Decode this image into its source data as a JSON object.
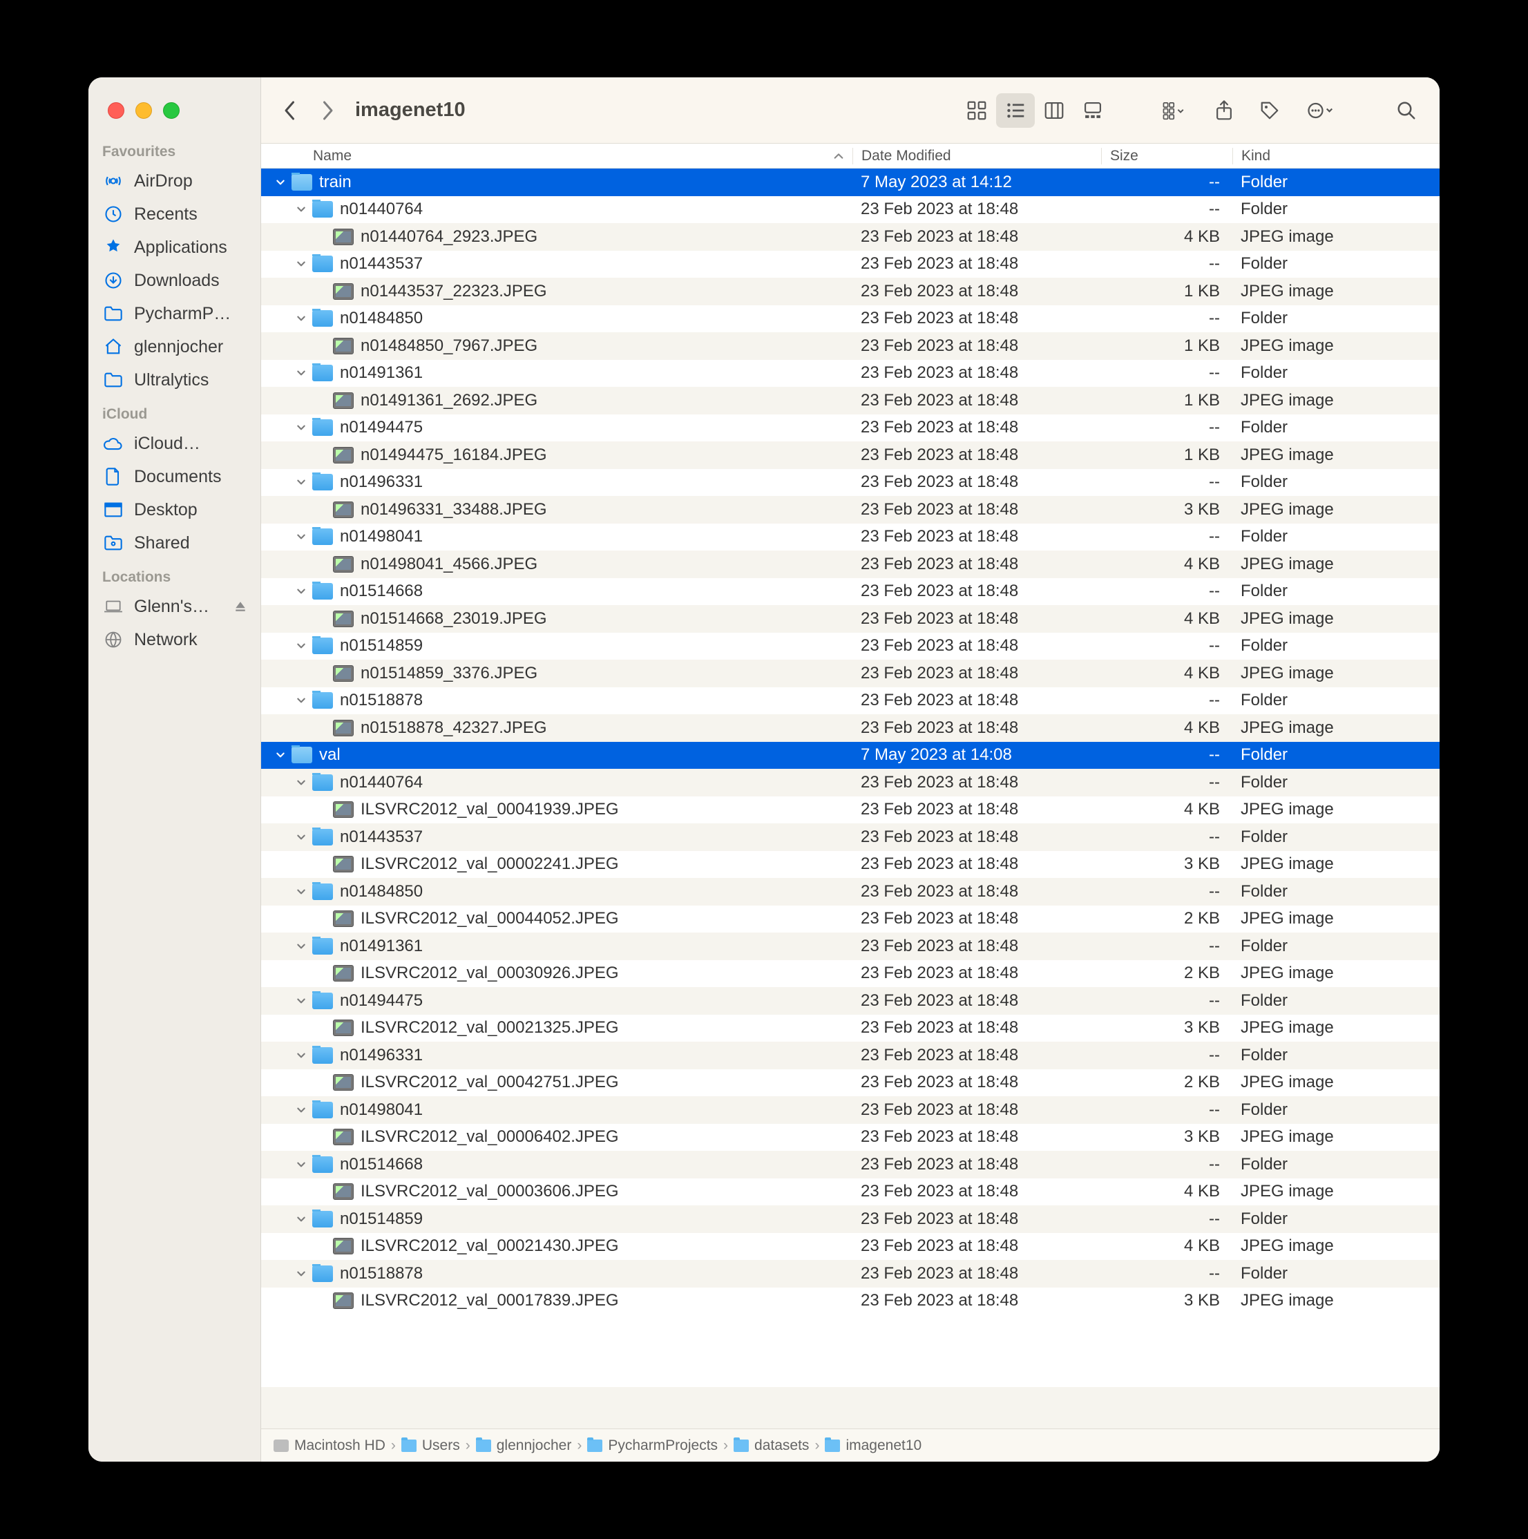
{
  "window": {
    "title": "imagenet10"
  },
  "sidebar": {
    "sections": [
      {
        "title": "Favourites",
        "items": [
          {
            "icon": "airdrop",
            "label": "AirDrop"
          },
          {
            "icon": "clock",
            "label": "Recents"
          },
          {
            "icon": "apps",
            "label": "Applications"
          },
          {
            "icon": "download",
            "label": "Downloads"
          },
          {
            "icon": "folder",
            "label": "PycharmP…"
          },
          {
            "icon": "home",
            "label": "glennjocher"
          },
          {
            "icon": "folder",
            "label": "Ultralytics"
          }
        ]
      },
      {
        "title": "iCloud",
        "items": [
          {
            "icon": "cloud",
            "label": "iCloud…"
          },
          {
            "icon": "doc",
            "label": "Documents"
          },
          {
            "icon": "desktop",
            "label": "Desktop"
          },
          {
            "icon": "shared",
            "label": "Shared"
          }
        ]
      },
      {
        "title": "Locations",
        "items": [
          {
            "icon": "laptop",
            "label": "Glenn's…",
            "eject": true
          },
          {
            "icon": "network",
            "label": "Network"
          }
        ]
      }
    ]
  },
  "columns": {
    "name": "Name",
    "date": "Date Modified",
    "size": "Size",
    "kind": "Kind"
  },
  "rows": [
    {
      "depth": 0,
      "type": "folder",
      "name": "train",
      "date": "7 May 2023 at 14:12",
      "size": "--",
      "kind": "Folder",
      "selected": true,
      "disclosed": true
    },
    {
      "depth": 1,
      "type": "folder",
      "name": "n01440764",
      "date": "23 Feb 2023 at 18:48",
      "size": "--",
      "kind": "Folder",
      "disclosed": true
    },
    {
      "depth": 2,
      "type": "img",
      "name": "n01440764_2923.JPEG",
      "date": "23 Feb 2023 at 18:48",
      "size": "4 KB",
      "kind": "JPEG image"
    },
    {
      "depth": 1,
      "type": "folder",
      "name": "n01443537",
      "date": "23 Feb 2023 at 18:48",
      "size": "--",
      "kind": "Folder",
      "disclosed": true
    },
    {
      "depth": 2,
      "type": "img",
      "name": "n01443537_22323.JPEG",
      "date": "23 Feb 2023 at 18:48",
      "size": "1 KB",
      "kind": "JPEG image"
    },
    {
      "depth": 1,
      "type": "folder",
      "name": "n01484850",
      "date": "23 Feb 2023 at 18:48",
      "size": "--",
      "kind": "Folder",
      "disclosed": true
    },
    {
      "depth": 2,
      "type": "img",
      "name": "n01484850_7967.JPEG",
      "date": "23 Feb 2023 at 18:48",
      "size": "1 KB",
      "kind": "JPEG image"
    },
    {
      "depth": 1,
      "type": "folder",
      "name": "n01491361",
      "date": "23 Feb 2023 at 18:48",
      "size": "--",
      "kind": "Folder",
      "disclosed": true
    },
    {
      "depth": 2,
      "type": "img",
      "name": "n01491361_2692.JPEG",
      "date": "23 Feb 2023 at 18:48",
      "size": "1 KB",
      "kind": "JPEG image"
    },
    {
      "depth": 1,
      "type": "folder",
      "name": "n01494475",
      "date": "23 Feb 2023 at 18:48",
      "size": "--",
      "kind": "Folder",
      "disclosed": true
    },
    {
      "depth": 2,
      "type": "img",
      "name": "n01494475_16184.JPEG",
      "date": "23 Feb 2023 at 18:48",
      "size": "1 KB",
      "kind": "JPEG image"
    },
    {
      "depth": 1,
      "type": "folder",
      "name": "n01496331",
      "date": "23 Feb 2023 at 18:48",
      "size": "--",
      "kind": "Folder",
      "disclosed": true
    },
    {
      "depth": 2,
      "type": "img",
      "name": "n01496331_33488.JPEG",
      "date": "23 Feb 2023 at 18:48",
      "size": "3 KB",
      "kind": "JPEG image"
    },
    {
      "depth": 1,
      "type": "folder",
      "name": "n01498041",
      "date": "23 Feb 2023 at 18:48",
      "size": "--",
      "kind": "Folder",
      "disclosed": true
    },
    {
      "depth": 2,
      "type": "img",
      "name": "n01498041_4566.JPEG",
      "date": "23 Feb 2023 at 18:48",
      "size": "4 KB",
      "kind": "JPEG image"
    },
    {
      "depth": 1,
      "type": "folder",
      "name": "n01514668",
      "date": "23 Feb 2023 at 18:48",
      "size": "--",
      "kind": "Folder",
      "disclosed": true
    },
    {
      "depth": 2,
      "type": "img",
      "name": "n01514668_23019.JPEG",
      "date": "23 Feb 2023 at 18:48",
      "size": "4 KB",
      "kind": "JPEG image"
    },
    {
      "depth": 1,
      "type": "folder",
      "name": "n01514859",
      "date": "23 Feb 2023 at 18:48",
      "size": "--",
      "kind": "Folder",
      "disclosed": true
    },
    {
      "depth": 2,
      "type": "img",
      "name": "n01514859_3376.JPEG",
      "date": "23 Feb 2023 at 18:48",
      "size": "4 KB",
      "kind": "JPEG image"
    },
    {
      "depth": 1,
      "type": "folder",
      "name": "n01518878",
      "date": "23 Feb 2023 at 18:48",
      "size": "--",
      "kind": "Folder",
      "disclosed": true
    },
    {
      "depth": 2,
      "type": "img",
      "name": "n01518878_42327.JPEG",
      "date": "23 Feb 2023 at 18:48",
      "size": "4 KB",
      "kind": "JPEG image"
    },
    {
      "depth": 0,
      "type": "folder",
      "name": "val",
      "date": "7 May 2023 at 14:08",
      "size": "--",
      "kind": "Folder",
      "selected": true,
      "disclosed": true
    },
    {
      "depth": 1,
      "type": "folder",
      "name": "n01440764",
      "date": "23 Feb 2023 at 18:48",
      "size": "--",
      "kind": "Folder",
      "disclosed": true
    },
    {
      "depth": 2,
      "type": "img",
      "name": "ILSVRC2012_val_00041939.JPEG",
      "date": "23 Feb 2023 at 18:48",
      "size": "4 KB",
      "kind": "JPEG image"
    },
    {
      "depth": 1,
      "type": "folder",
      "name": "n01443537",
      "date": "23 Feb 2023 at 18:48",
      "size": "--",
      "kind": "Folder",
      "disclosed": true
    },
    {
      "depth": 2,
      "type": "img",
      "name": "ILSVRC2012_val_00002241.JPEG",
      "date": "23 Feb 2023 at 18:48",
      "size": "3 KB",
      "kind": "JPEG image"
    },
    {
      "depth": 1,
      "type": "folder",
      "name": "n01484850",
      "date": "23 Feb 2023 at 18:48",
      "size": "--",
      "kind": "Folder",
      "disclosed": true
    },
    {
      "depth": 2,
      "type": "img",
      "name": "ILSVRC2012_val_00044052.JPEG",
      "date": "23 Feb 2023 at 18:48",
      "size": "2 KB",
      "kind": "JPEG image"
    },
    {
      "depth": 1,
      "type": "folder",
      "name": "n01491361",
      "date": "23 Feb 2023 at 18:48",
      "size": "--",
      "kind": "Folder",
      "disclosed": true
    },
    {
      "depth": 2,
      "type": "img",
      "name": "ILSVRC2012_val_00030926.JPEG",
      "date": "23 Feb 2023 at 18:48",
      "size": "2 KB",
      "kind": "JPEG image"
    },
    {
      "depth": 1,
      "type": "folder",
      "name": "n01494475",
      "date": "23 Feb 2023 at 18:48",
      "size": "--",
      "kind": "Folder",
      "disclosed": true
    },
    {
      "depth": 2,
      "type": "img",
      "name": "ILSVRC2012_val_00021325.JPEG",
      "date": "23 Feb 2023 at 18:48",
      "size": "3 KB",
      "kind": "JPEG image"
    },
    {
      "depth": 1,
      "type": "folder",
      "name": "n01496331",
      "date": "23 Feb 2023 at 18:48",
      "size": "--",
      "kind": "Folder",
      "disclosed": true
    },
    {
      "depth": 2,
      "type": "img",
      "name": "ILSVRC2012_val_00042751.JPEG",
      "date": "23 Feb 2023 at 18:48",
      "size": "2 KB",
      "kind": "JPEG image"
    },
    {
      "depth": 1,
      "type": "folder",
      "name": "n01498041",
      "date": "23 Feb 2023 at 18:48",
      "size": "--",
      "kind": "Folder",
      "disclosed": true
    },
    {
      "depth": 2,
      "type": "img",
      "name": "ILSVRC2012_val_00006402.JPEG",
      "date": "23 Feb 2023 at 18:48",
      "size": "3 KB",
      "kind": "JPEG image"
    },
    {
      "depth": 1,
      "type": "folder",
      "name": "n01514668",
      "date": "23 Feb 2023 at 18:48",
      "size": "--",
      "kind": "Folder",
      "disclosed": true
    },
    {
      "depth": 2,
      "type": "img",
      "name": "ILSVRC2012_val_00003606.JPEG",
      "date": "23 Feb 2023 at 18:48",
      "size": "4 KB",
      "kind": "JPEG image"
    },
    {
      "depth": 1,
      "type": "folder",
      "name": "n01514859",
      "date": "23 Feb 2023 at 18:48",
      "size": "--",
      "kind": "Folder",
      "disclosed": true
    },
    {
      "depth": 2,
      "type": "img",
      "name": "ILSVRC2012_val_00021430.JPEG",
      "date": "23 Feb 2023 at 18:48",
      "size": "4 KB",
      "kind": "JPEG image"
    },
    {
      "depth": 1,
      "type": "folder",
      "name": "n01518878",
      "date": "23 Feb 2023 at 18:48",
      "size": "--",
      "kind": "Folder",
      "disclosed": true
    },
    {
      "depth": 2,
      "type": "img",
      "name": "ILSVRC2012_val_00017839.JPEG",
      "date": "23 Feb 2023 at 18:48",
      "size": "3 KB",
      "kind": "JPEG image"
    }
  ],
  "pathbar": [
    {
      "icon": "hd",
      "label": "Macintosh HD"
    },
    {
      "icon": "folder",
      "label": "Users"
    },
    {
      "icon": "folder",
      "label": "glennjocher"
    },
    {
      "icon": "folder",
      "label": "PycharmProjects"
    },
    {
      "icon": "folder",
      "label": "datasets"
    },
    {
      "icon": "folder",
      "label": "imagenet10"
    }
  ]
}
